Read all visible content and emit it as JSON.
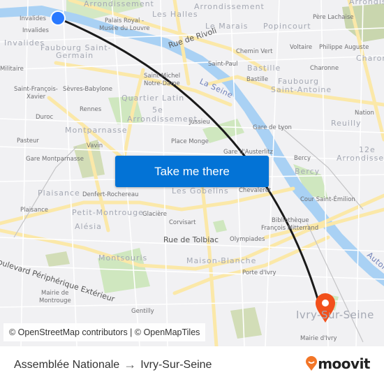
{
  "map": {
    "origin_marker": {
      "name": "Assemblée Nationale",
      "color": "#2979ff"
    },
    "destination_marker": {
      "name": "Ivry-Sur-Seine",
      "color": "#f2501b"
    },
    "route_color": "#1a1a1a",
    "labels": [
      {
        "text": "Arrondissement",
        "kind": "dist"
      },
      {
        "text": "Les Halles",
        "kind": "dist"
      },
      {
        "text": "Arrondissement",
        "kind": "dist"
      },
      {
        "text": "Arrondissement",
        "kind": "dist"
      },
      {
        "text": "Invalides",
        "kind": "poi"
      },
      {
        "text": "Invalides",
        "kind": "poi"
      },
      {
        "text": "Invalides",
        "kind": "dist"
      },
      {
        "text": "Palais Royal -",
        "kind": "poi"
      },
      {
        "text": "Musée du Louvre",
        "kind": "poi"
      },
      {
        "text": "Père Lachaise",
        "kind": "poi"
      },
      {
        "text": "Le Marais",
        "kind": "dist"
      },
      {
        "text": "Popincourt",
        "kind": "dist"
      },
      {
        "text": "Faubourg Saint-",
        "kind": "dist"
      },
      {
        "text": "Germain",
        "kind": "dist"
      },
      {
        "text": "Rue de Rivoli",
        "kind": "street"
      },
      {
        "text": "Chemin Vert",
        "kind": "poi"
      },
      {
        "text": "Voltaire",
        "kind": "poi"
      },
      {
        "text": "Philippe Auguste",
        "kind": "poi"
      },
      {
        "text": "Charonne",
        "kind": "dist"
      },
      {
        "text": "Militaire",
        "kind": "poi"
      },
      {
        "text": "Saint-Paul",
        "kind": "poi"
      },
      {
        "text": "Bastille",
        "kind": "dist"
      },
      {
        "text": "Charonne",
        "kind": "poi"
      },
      {
        "text": "Saint-Michel",
        "kind": "poi"
      },
      {
        "text": "Notre-Dame",
        "kind": "poi"
      },
      {
        "text": "La Seine",
        "kind": "river"
      },
      {
        "text": "Bastille",
        "kind": "poi"
      },
      {
        "text": "Faubourg",
        "kind": "dist"
      },
      {
        "text": "Saint-Antoine",
        "kind": "dist"
      },
      {
        "text": "Saint-François-",
        "kind": "poi"
      },
      {
        "text": "Xavier",
        "kind": "poi"
      },
      {
        "text": "Sèvres-Babylone",
        "kind": "poi"
      },
      {
        "text": "Quartier Latin",
        "kind": "dist"
      },
      {
        "text": "Rennes",
        "kind": "poi"
      },
      {
        "text": "5e",
        "kind": "dist"
      },
      {
        "text": "Arrondissement",
        "kind": "dist"
      },
      {
        "text": "Jussieu",
        "kind": "poi"
      },
      {
        "text": "Nation",
        "kind": "poi"
      },
      {
        "text": "Duroc",
        "kind": "poi"
      },
      {
        "text": "Reuilly",
        "kind": "dist"
      },
      {
        "text": "Gare de Lyon",
        "kind": "poi"
      },
      {
        "text": "Montparnasse",
        "kind": "dist"
      },
      {
        "text": "Pasteur",
        "kind": "poi"
      },
      {
        "text": "Vavin",
        "kind": "poi"
      },
      {
        "text": "Place Monge",
        "kind": "poi"
      },
      {
        "text": "Gare d'Austerlitz",
        "kind": "poi"
      },
      {
        "text": "12e",
        "kind": "dist"
      },
      {
        "text": "Arrondissement",
        "kind": "dist"
      },
      {
        "text": "Gare Montparnasse",
        "kind": "poi"
      },
      {
        "text": "Bercy",
        "kind": "poi"
      },
      {
        "text": "Bercy",
        "kind": "dist"
      },
      {
        "text": "Plaisance",
        "kind": "dist"
      },
      {
        "text": "Denfert-Rochereau",
        "kind": "poi"
      },
      {
        "text": "Les Gobelins",
        "kind": "dist"
      },
      {
        "text": "Chevaleret",
        "kind": "poi"
      },
      {
        "text": "Cour Saint-Émilion",
        "kind": "poi"
      },
      {
        "text": "Plaisance",
        "kind": "poi"
      },
      {
        "text": "Petit-Montrouge",
        "kind": "dist"
      },
      {
        "text": "Glacière",
        "kind": "poi"
      },
      {
        "text": "Bibliothèque",
        "kind": "poi"
      },
      {
        "text": "François Mitterrand",
        "kind": "poi"
      },
      {
        "text": "Corvisart",
        "kind": "poi"
      },
      {
        "text": "Alésia",
        "kind": "dist"
      },
      {
        "text": "Rue de Tolbiac",
        "kind": "street"
      },
      {
        "text": "Olympiades",
        "kind": "poi"
      },
      {
        "text": "Boulevard Périphérique Extérieur",
        "kind": "street"
      },
      {
        "text": "Montsouris",
        "kind": "dist"
      },
      {
        "text": "Maison-Blanche",
        "kind": "dist"
      },
      {
        "text": "Autoroute",
        "kind": "river"
      },
      {
        "text": "Porte d'Ivry",
        "kind": "poi"
      },
      {
        "text": "Mairie de",
        "kind": "poi"
      },
      {
        "text": "Montrouge",
        "kind": "poi"
      },
      {
        "text": "Gentilly",
        "kind": "poi"
      },
      {
        "text": "Ivry-Sur-Seine",
        "kind": "big"
      },
      {
        "text": "Mairie d'Ivry",
        "kind": "poi"
      }
    ],
    "cta_label": "Take me there",
    "attribution": "© OpenStreetMap contributors | © OpenMapTiles"
  },
  "footer": {
    "origin": "Assemblée Nationale",
    "arrow": "→",
    "destination": "Ivry-Sur-Seine",
    "brand": "moovit",
    "brand_color": "#f27527"
  }
}
